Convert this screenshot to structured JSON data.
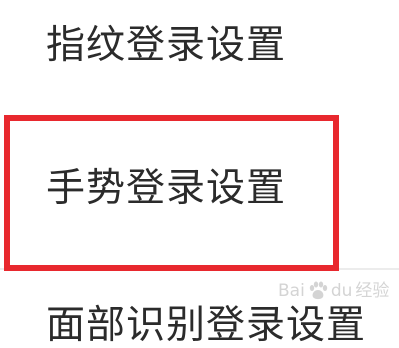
{
  "menu": {
    "items": [
      {
        "label": "指纹登录设置"
      },
      {
        "label": "手势登录设置"
      },
      {
        "label": "面部识别登录设置"
      }
    ]
  },
  "annotation": {
    "highlight_color": "#e8282e",
    "highlighted_item": "手势登录设置"
  },
  "watermark": {
    "text_left": "Bai",
    "text_mid": "du",
    "text_right": "经验",
    "icon": "paw-icon"
  }
}
